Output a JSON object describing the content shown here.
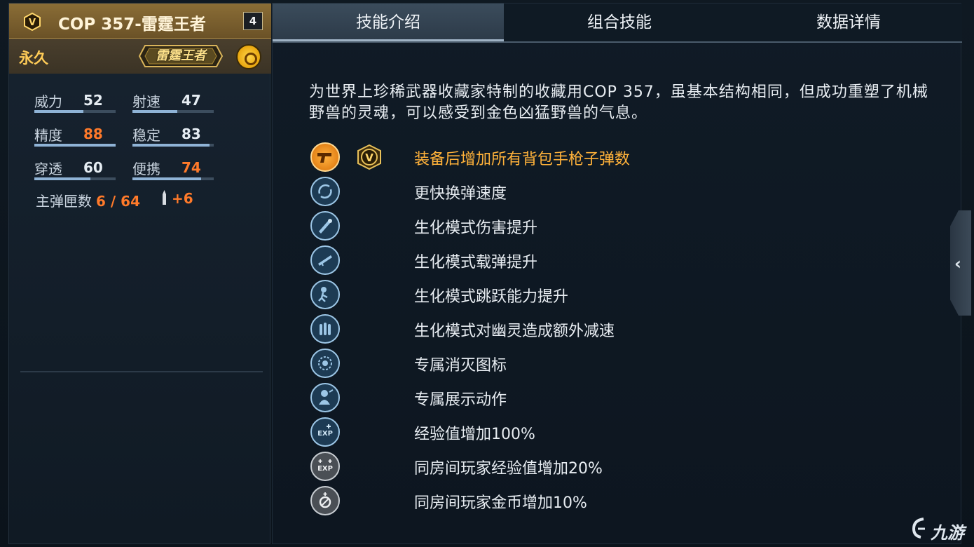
{
  "weapon": {
    "name": "COP 357-雷霆王者",
    "level": "4",
    "duration": "永久",
    "tag_logo_text": "雷霆王者"
  },
  "stats": [
    {
      "label": "威力",
      "value": "52",
      "highlight": false,
      "fill": 0.6
    },
    {
      "label": "射速",
      "value": "47",
      "highlight": false,
      "fill": 0.55
    },
    {
      "label": "精度",
      "value": "88",
      "highlight": true,
      "fill": 1.0
    },
    {
      "label": "稳定",
      "value": "83",
      "highlight": false,
      "fill": 0.95
    },
    {
      "label": "穿透",
      "value": "60",
      "highlight": false,
      "fill": 0.7
    },
    {
      "label": "便携",
      "value": "74",
      "highlight": true,
      "fill": 0.85
    }
  ],
  "ammo": {
    "label": "主弹匣数",
    "value": "6 / 64",
    "bonus": "+6"
  },
  "tabs": [
    {
      "label": "技能介绍",
      "active": true
    },
    {
      "label": "组合技能",
      "active": false
    },
    {
      "label": "数据详情",
      "active": false
    }
  ],
  "description": "为世界上珍稀武器收藏家特制的收藏用COP 357，虽基本结构相同，但成功重塑了机械野兽的灵魂，可以感受到金色凶猛野兽的气息。",
  "skills": [
    {
      "icon": "pistol-icon",
      "style": "gold",
      "text": "装备后增加所有背包手枪子弹数",
      "highlight": true
    },
    {
      "icon": "reload-icon",
      "style": "blue",
      "text": "更快换弹速度",
      "highlight": false
    },
    {
      "icon": "zombie-damage-icon",
      "style": "blue",
      "text": "生化模式伤害提升",
      "highlight": false
    },
    {
      "icon": "zombie-ammo-icon",
      "style": "blue",
      "text": "生化模式载弹提升",
      "highlight": false
    },
    {
      "icon": "zombie-jump-icon",
      "style": "blue",
      "text": "生化模式跳跃能力提升",
      "highlight": false
    },
    {
      "icon": "bullets-icon",
      "style": "blue",
      "text": "生化模式对幽灵造成额外减速",
      "highlight": false
    },
    {
      "icon": "kill-mark-icon",
      "style": "blue",
      "text": "专属消灭图标",
      "highlight": false
    },
    {
      "icon": "showcase-icon",
      "style": "blue",
      "text": "专属展示动作",
      "highlight": false
    },
    {
      "icon": "exp-icon",
      "style": "blue",
      "text": "经验值增加100%",
      "highlight": false
    },
    {
      "icon": "room-exp-icon",
      "style": "gray",
      "text": "同房间玩家经验值增加20%",
      "highlight": false
    },
    {
      "icon": "room-coin-icon",
      "style": "gray",
      "text": "同房间玩家金币增加10%",
      "highlight": false
    }
  ],
  "watermark": "九游",
  "colors": {
    "gold": "#ffb23a",
    "highlight_value": "#ff7a2a",
    "icon_blue": "#9cc6e6"
  }
}
